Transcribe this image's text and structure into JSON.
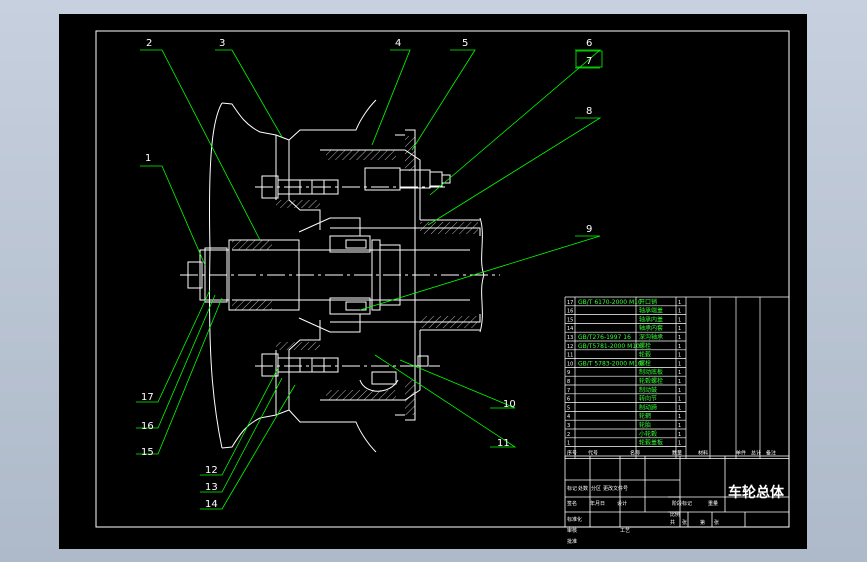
{
  "drawing": {
    "colors": {
      "canvas": "#000000",
      "frame": "#ffffff",
      "outline": "#ffffff",
      "leader": "#00ff00",
      "centerline": "#ffffff",
      "hatch": "#ffffff",
      "bom_green": "#35ff35"
    },
    "part_labels": [
      "1",
      "2",
      "3",
      "4",
      "5",
      "6",
      "7",
      "8",
      "9",
      "10",
      "11",
      "12",
      "13",
      "14",
      "15",
      "16",
      "17"
    ],
    "bom": {
      "rows": [
        {
          "no": "17",
          "code": "GB/T 6170-2000 M10",
          "name": "开口销",
          "qty": "1"
        },
        {
          "no": "16",
          "code": "",
          "name": "轴承端盖",
          "qty": "1"
        },
        {
          "no": "15",
          "code": "",
          "name": "轴承内盖",
          "qty": "1"
        },
        {
          "no": "14",
          "code": "",
          "name": "轴承内套",
          "qty": "1"
        },
        {
          "no": "13",
          "code": "GB/T276-1997 16",
          "name": "深沟轴承",
          "qty": "1"
        },
        {
          "no": "12",
          "code": "GB/T5781-2000 M10",
          "name": "螺栓",
          "qty": "1"
        },
        {
          "no": "11",
          "code": "",
          "name": "轮毂",
          "qty": "1"
        },
        {
          "no": "10",
          "code": "GB/T 5783-2000 M10",
          "name": "螺栓",
          "qty": "1"
        },
        {
          "no": "9",
          "code": "",
          "name": "制动底板",
          "qty": "1"
        },
        {
          "no": "8",
          "code": "",
          "name": "轮毂螺栓",
          "qty": "1"
        },
        {
          "no": "7",
          "code": "",
          "name": "制动鼓",
          "qty": "1"
        },
        {
          "no": "6",
          "code": "",
          "name": "转向节",
          "qty": "1"
        },
        {
          "no": "5",
          "code": "",
          "name": "制动蹄",
          "qty": "1"
        },
        {
          "no": "4",
          "code": "",
          "name": "轮辋",
          "qty": "1"
        },
        {
          "no": "3",
          "code": "",
          "name": "轮胎",
          "qty": "1"
        },
        {
          "no": "2",
          "code": "",
          "name": "小轮毂",
          "qty": "1"
        },
        {
          "no": "1",
          "code": "",
          "name": "轮毂盖板",
          "qty": "1"
        }
      ],
      "headers": [
        "序号",
        "代号",
        "名称",
        "数量",
        "材料",
        "单件",
        "总计",
        "备注"
      ]
    },
    "title_block": {
      "title": "车轮总体",
      "labels": [
        "标记",
        "处数",
        "分区",
        "更改文件号",
        "签名",
        "年月日",
        "设计",
        "标准化",
        "阶段标记",
        "重量",
        "比例",
        "审核",
        "工艺",
        "批准",
        "共",
        "张",
        "第",
        "张"
      ]
    }
  }
}
